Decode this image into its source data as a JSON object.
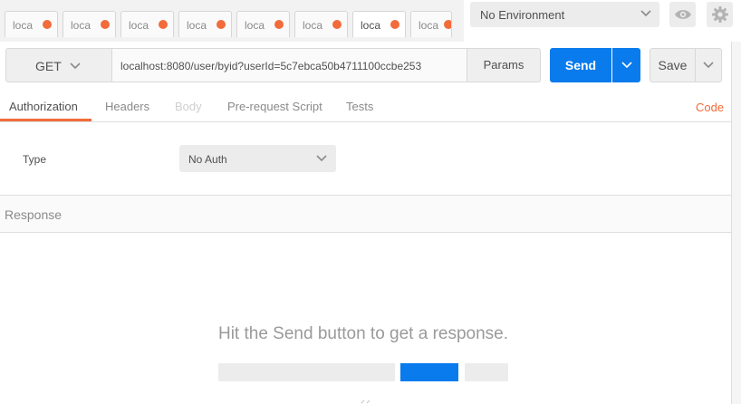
{
  "tabs": [
    {
      "label": "loca",
      "active": false,
      "unsaved": true
    },
    {
      "label": "loca",
      "active": false,
      "unsaved": true
    },
    {
      "label": "loca",
      "active": false,
      "unsaved": true
    },
    {
      "label": "loca",
      "active": false,
      "unsaved": true
    },
    {
      "label": "loca",
      "active": false,
      "unsaved": true
    },
    {
      "label": "loca",
      "active": false,
      "unsaved": true
    },
    {
      "label": "loca",
      "active": true,
      "unsaved": true
    },
    {
      "label": "loca",
      "active": false,
      "unsaved": true
    }
  ],
  "environment": {
    "selected": "No Environment",
    "icons": [
      "eye-icon",
      "gear-icon"
    ]
  },
  "request": {
    "method": "GET",
    "url": "localhost:8080/user/byid?userId=5c7ebca50b4711100ccbe253",
    "params_label": "Params",
    "send_label": "Send",
    "save_label": "Save"
  },
  "subtabs": {
    "items": [
      "Authorization",
      "Headers",
      "Body",
      "Pre-request Script",
      "Tests"
    ],
    "code_label": "Code"
  },
  "auth": {
    "type_label": "Type",
    "selected": "No Auth"
  },
  "response": {
    "label": "Response",
    "hint": "Hit the Send button to get a response."
  },
  "colors": {
    "accent": "#f26b3a",
    "primary": "#097bed",
    "background": "#ffffff"
  }
}
